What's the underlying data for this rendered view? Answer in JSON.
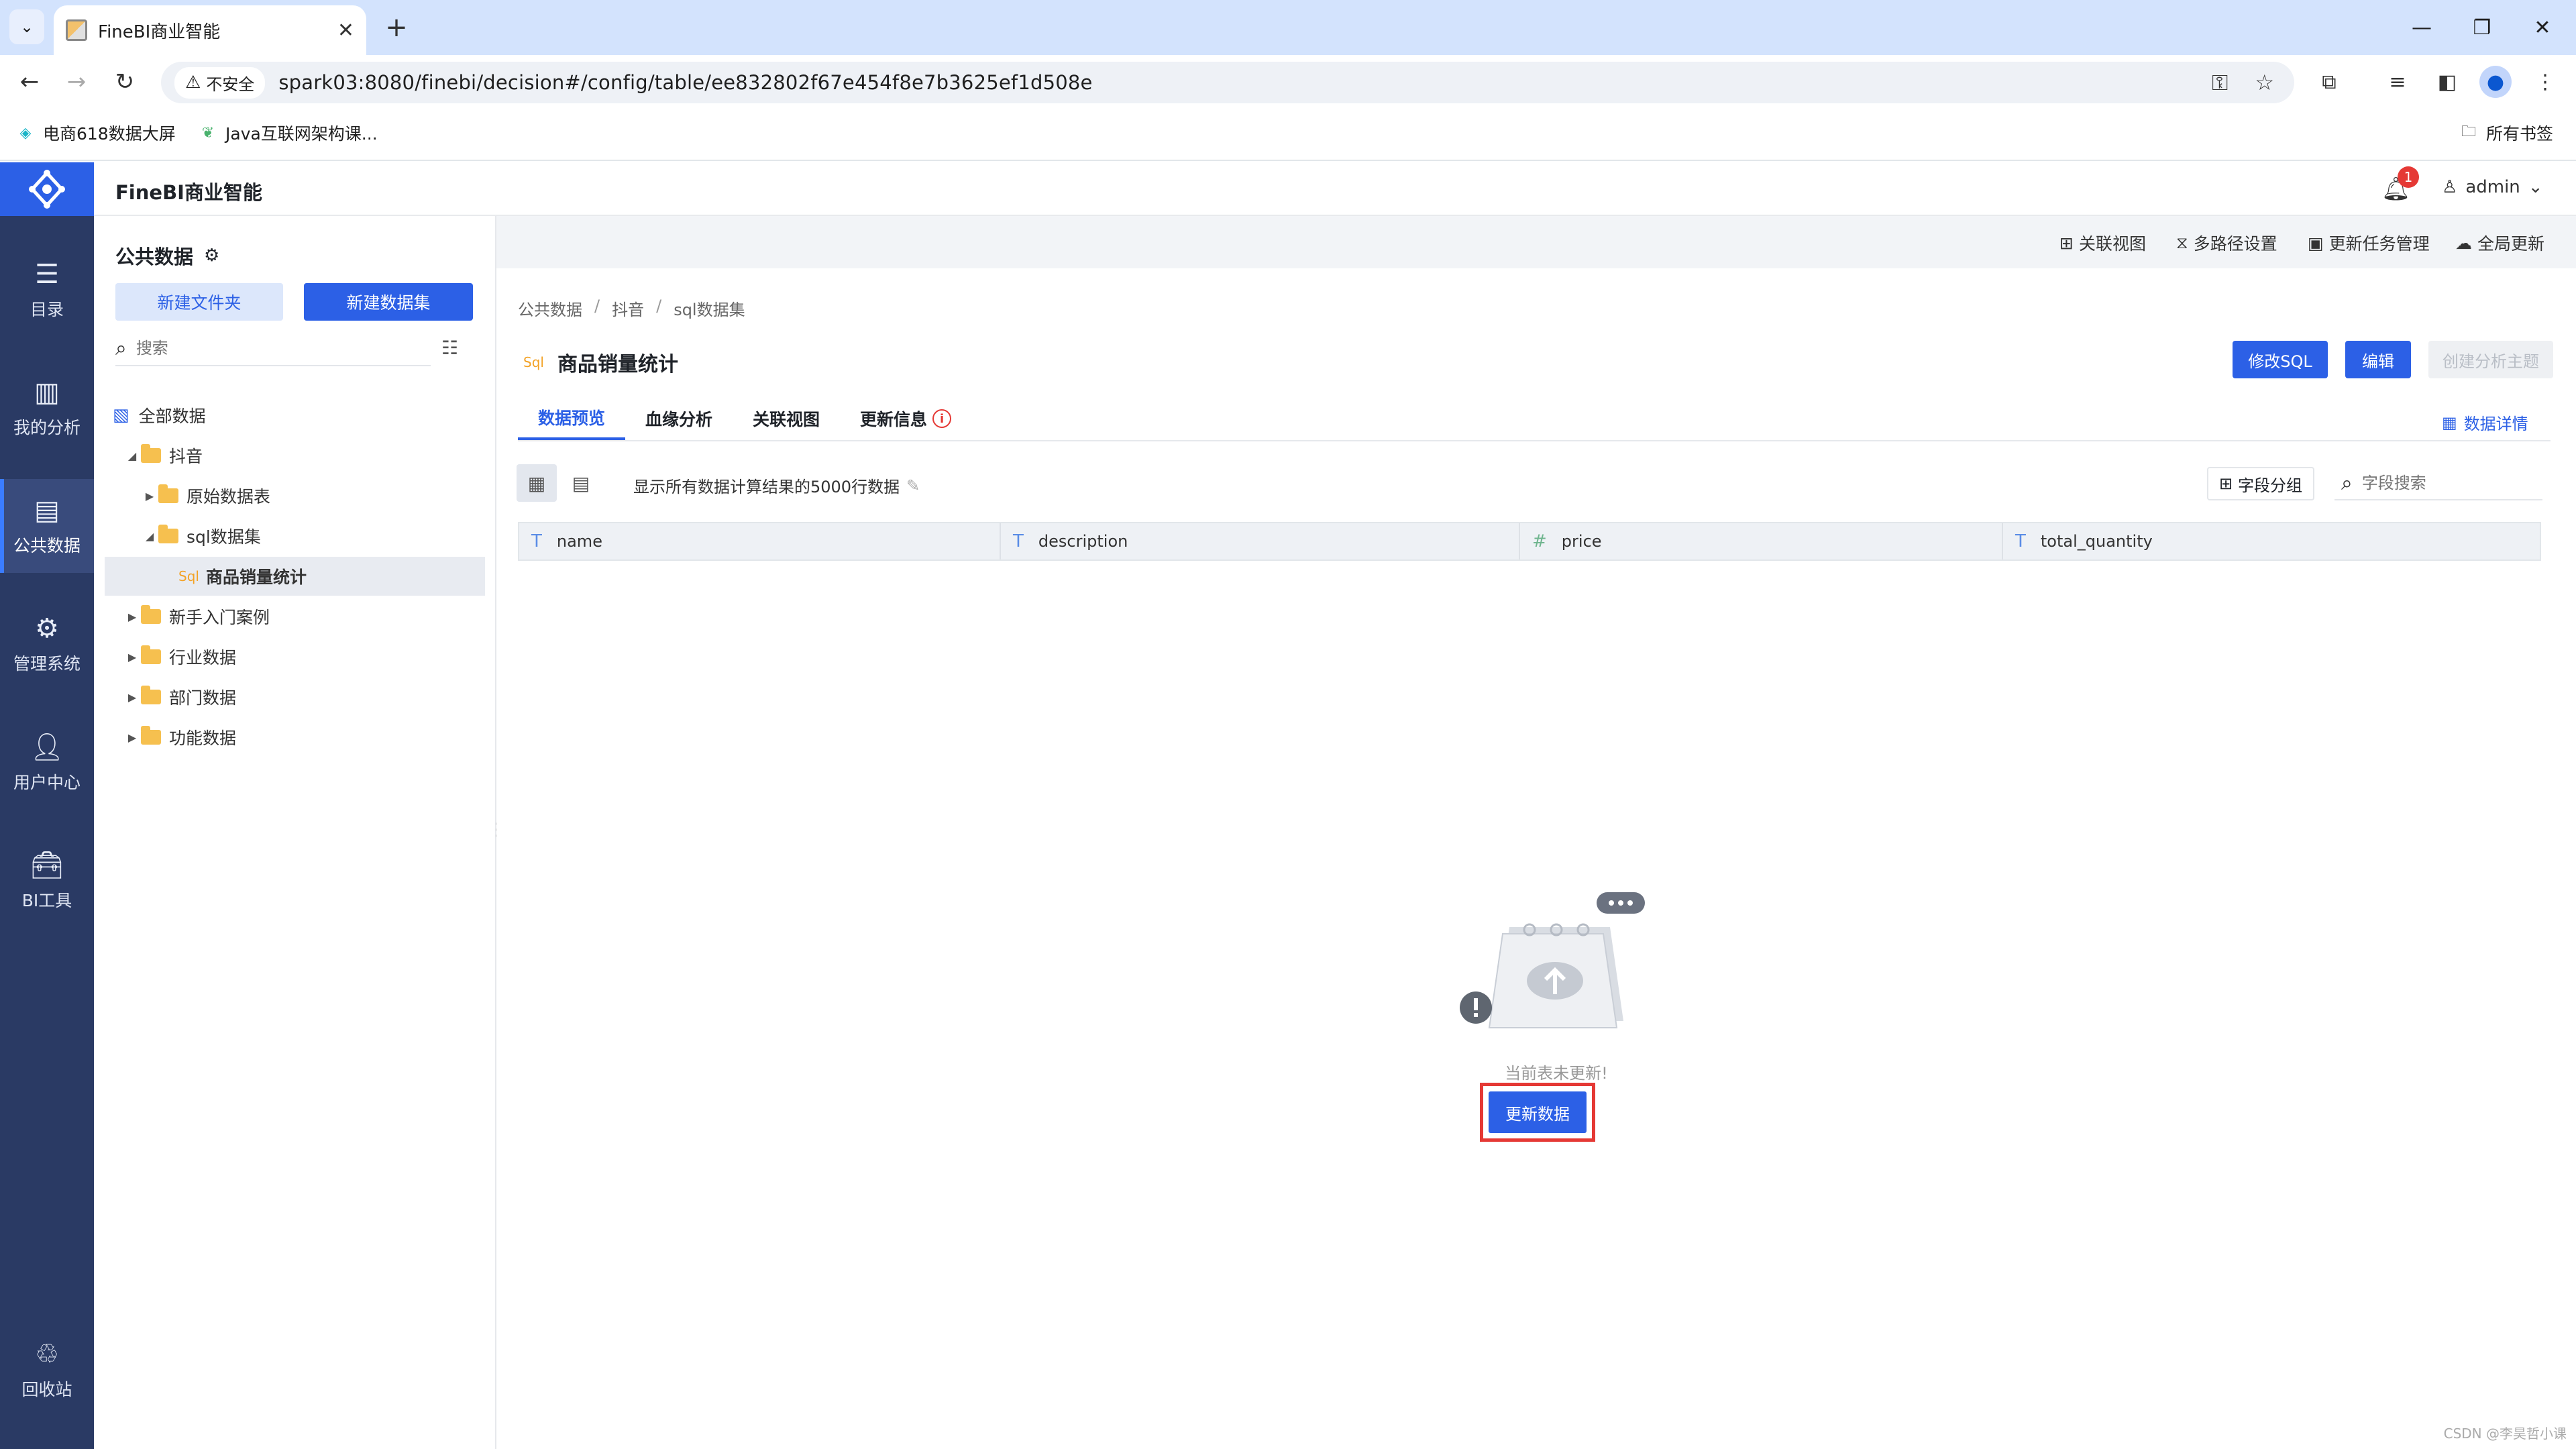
{
  "browser": {
    "tab_title": "FineBI商业智能",
    "security_label": "不安全",
    "url": "spark03:8080/finebi/decision#/config/table/ee832802f67e454f8e7b3625ef1d508e",
    "bookmarks": [
      {
        "label": "电商618数据大屏"
      },
      {
        "label": "Java互联网架构课..."
      }
    ],
    "all_bookmarks": "所有书签"
  },
  "header": {
    "app_title": "FineBI商业智能",
    "notification_count": "1",
    "user": "admin"
  },
  "rail": {
    "items": [
      {
        "label": "目录",
        "icon": "catalog-icon"
      },
      {
        "label": "我的分析",
        "icon": "analysis-icon"
      },
      {
        "label": "公共数据",
        "icon": "public-data-icon",
        "active": true
      },
      {
        "label": "管理系统",
        "icon": "settings-icon"
      },
      {
        "label": "用户中心",
        "icon": "user-icon"
      },
      {
        "label": "BI工具",
        "icon": "toolbox-icon"
      }
    ],
    "recycle": "回收站"
  },
  "tree_panel": {
    "title": "公共数据",
    "new_folder": "新建文件夹",
    "new_dataset": "新建数据集",
    "search_placeholder": "搜索",
    "nodes": [
      {
        "label": "全部数据"
      },
      {
        "label": "抖音"
      },
      {
        "label": "原始数据表"
      },
      {
        "label": "sql数据集"
      },
      {
        "label": "商品销量统计",
        "tag": "Sql"
      },
      {
        "label": "新手入门案例"
      },
      {
        "label": "行业数据"
      },
      {
        "label": "部门数据"
      },
      {
        "label": "功能数据"
      }
    ]
  },
  "actions": {
    "related_view": "关联视图",
    "multi_path": "多路径设置",
    "update_task": "更新任务管理",
    "global_update": "全局更新"
  },
  "breadcrumb": [
    "公共数据",
    "抖音",
    "sql数据集"
  ],
  "table": {
    "tag": "Sql",
    "title": "商品销量统计",
    "edit_sql": "修改SQL",
    "edit": "编辑",
    "create_theme": "创建分析主题"
  },
  "tabs": [
    "数据预览",
    "血缘分析",
    "关联视图",
    "更新信息"
  ],
  "data_detail": "数据详情",
  "preview": {
    "row_hint": "显示所有数据计算结果的5000行数据",
    "field_group": "字段分组",
    "field_search_placeholder": "字段搜索",
    "columns": [
      {
        "type": "T",
        "name": "name"
      },
      {
        "type": "T",
        "name": "description"
      },
      {
        "type": "#",
        "name": "price"
      },
      {
        "type": "T",
        "name": "total_quantity"
      }
    ]
  },
  "empty_state": {
    "message": "当前表未更新!",
    "button": "更新数据"
  },
  "watermark": "CSDN @李昊哲小课",
  "colors": {
    "primary": "#2c60e6",
    "rail_bg": "#2a3a64",
    "highlight": "#e53935"
  }
}
